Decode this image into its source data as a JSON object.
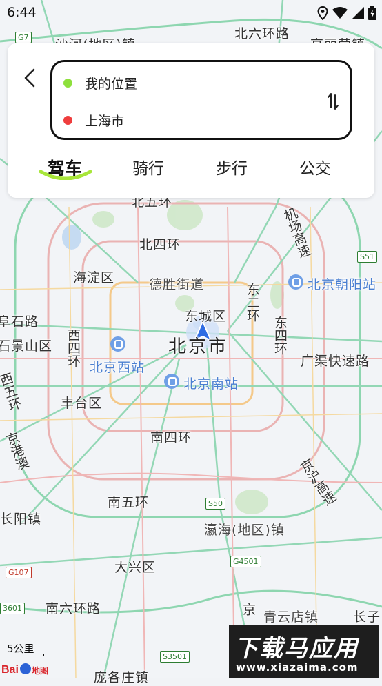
{
  "status_bar": {
    "time": "6:44"
  },
  "route": {
    "origin": "我的位置",
    "destination": "上海市",
    "origin_color": "#8ee03c",
    "destination_color": "#ef3d3d"
  },
  "modes": [
    {
      "label": "驾车",
      "active": true
    },
    {
      "label": "骑行",
      "active": false
    },
    {
      "label": "步行",
      "active": false
    },
    {
      "label": "公交",
      "active": false
    }
  ],
  "map": {
    "labels": {
      "haidian": "海淀区",
      "deshengjiedao": "德胜街道",
      "dongcheng": "东城区",
      "beijing": "北京市",
      "shijingshan": "石景山区",
      "fushilu": "阜石路",
      "fengtai": "丰台区",
      "daxing": "大兴区",
      "changyang": "长阳镇",
      "yinghai": "瀛海(地区)镇",
      "qingyundian": "青云店镇",
      "changzi": "长子",
      "pangezhuang": "庞各庄镇",
      "shahe": "沙河(地区)镇",
      "beiliuhuan": "北六环路",
      "gaoliying": "高丽营镇",
      "beiwuhuan": "北五环",
      "beisihuan": "北四环",
      "nansihuan": "南四环",
      "nanwuhuan": "南五环",
      "nanliuhuan": "南六环路",
      "jichanggaosu": "机场高速",
      "dongerhuan": "东二环",
      "dongsihuan": "东四环",
      "xisihuan": "西四环",
      "xiwuhuan": "西五环",
      "jinggangao": "京港澳",
      "jinghugaosu": "京沪高速",
      "guangqu": "广渠快速路",
      "jing": "京",
      "station_chaoyang": "北京朝阳站",
      "station_xi": "北京西站",
      "station_nan": "北京南站"
    },
    "shields": {
      "s51": "S51",
      "g7": "G7",
      "s50": "S50",
      "g4501": "G4501",
      "g107": "G107",
      "s3501": "S3501",
      "g3601": "3601"
    }
  },
  "scale": "5公里",
  "logo": "Baidu地图",
  "watermark": {
    "title": "下载马应用",
    "url": "www.xiazaima.com"
  }
}
